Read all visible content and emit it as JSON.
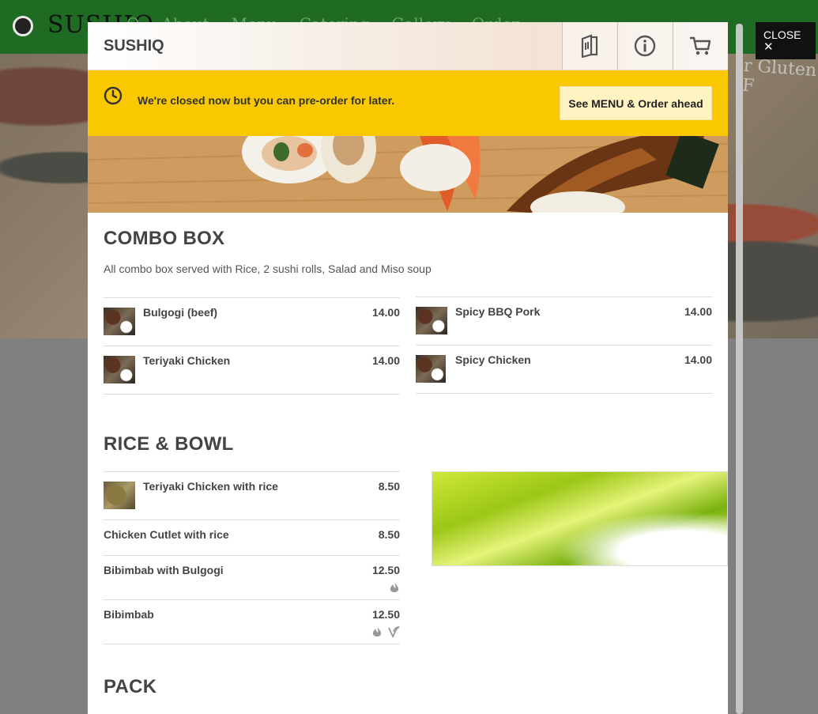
{
  "background": {
    "brand": "SUSHIQ",
    "nav": [
      "Q",
      "About",
      "Menu",
      "Catering",
      "Gallery",
      "Order"
    ],
    "sign": "r Gluten F"
  },
  "close_button": {
    "label": "CLOSE",
    "icon": "close-icon",
    "glyph": "✕"
  },
  "modal": {
    "title": "SUSHIQ",
    "header_buttons": [
      {
        "icon": "menu-book-icon"
      },
      {
        "icon": "info-icon"
      },
      {
        "icon": "cart-icon"
      }
    ],
    "notice": {
      "text": "We're closed now but you can pre-order for later.",
      "button": "See MENU & Order ahead",
      "icon": "clock-icon",
      "color": "#f9c800"
    }
  },
  "sections": [
    {
      "title": "COMBO BOX",
      "description": "All combo box served with Rice, 2 sushi rolls, Salad and Miso soup",
      "items": [
        {
          "name": "Bulgogi (beef)",
          "price": "14.00"
        },
        {
          "name": "Spicy BBQ Pork",
          "price": "14.00"
        },
        {
          "name": "Teriyaki Chicken",
          "price": "14.00"
        },
        {
          "name": "Spicy Chicken",
          "price": "14.00"
        }
      ]
    },
    {
      "title": "RICE & BOWL",
      "items": [
        {
          "name": "Teriyaki Chicken with rice",
          "price": "8.50"
        },
        {
          "name": "Chicken Cutlet with rice",
          "price": "8.50"
        },
        {
          "name": "Bibimbab with Bulgogi",
          "price": "12.50",
          "icons": [
            "spicy-icon"
          ]
        },
        {
          "name": "Bibimbab",
          "price": "12.50",
          "icons": [
            "spicy-icon",
            "vegetarian-icon"
          ]
        }
      ]
    },
    {
      "title": "PACK"
    }
  ]
}
